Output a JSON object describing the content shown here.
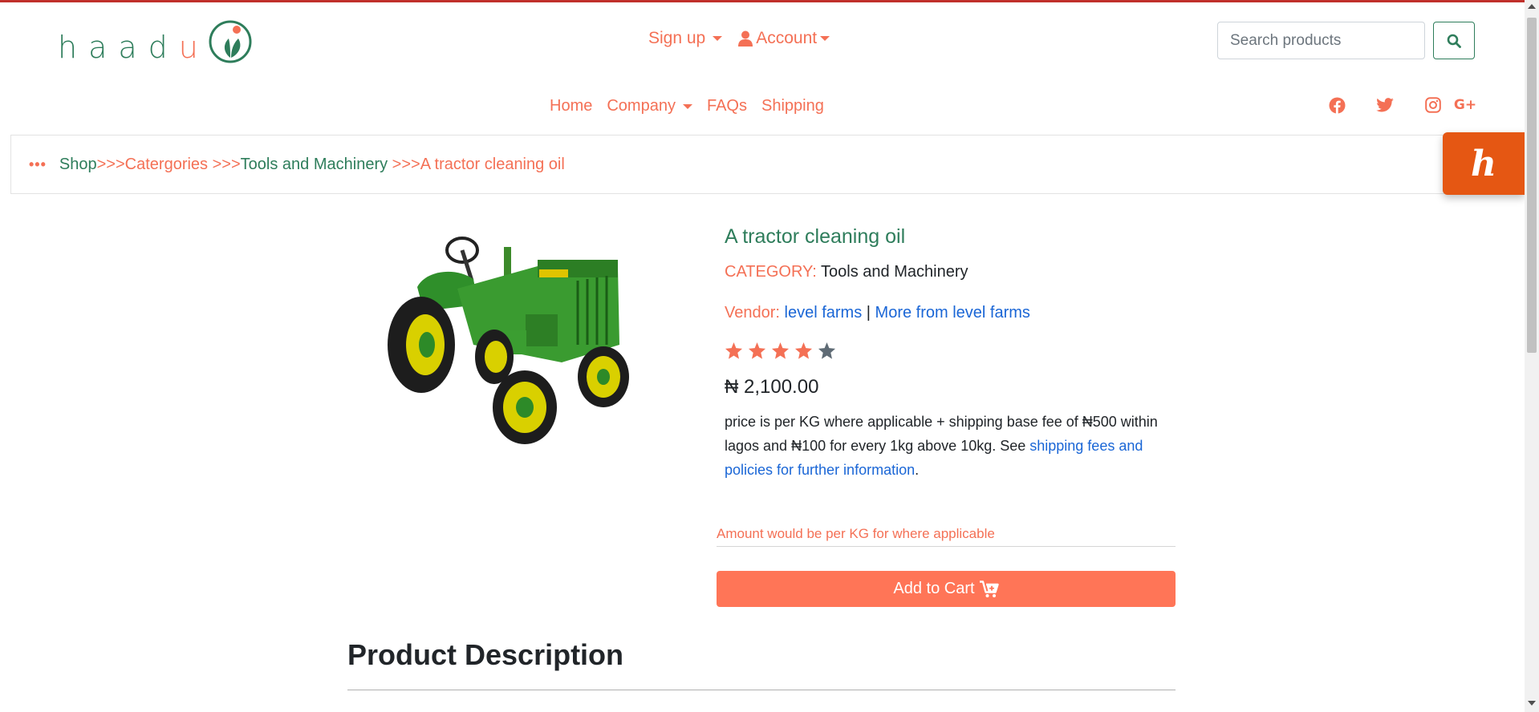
{
  "brand": {
    "logo_text_main": "haad",
    "logo_text_accent": "u"
  },
  "topnav": {
    "signup_label": "Sign up",
    "account_label": "Account"
  },
  "search": {
    "placeholder": "Search products"
  },
  "mainnav": {
    "home": "Home",
    "company": "Company",
    "faqs": "FAQs",
    "shipping": "Shipping"
  },
  "social": {
    "googleplus_label": "G+"
  },
  "breadcrumb": {
    "dots": "•••",
    "shop": "Shop",
    "sep1": ">>>",
    "categories": "Catergories",
    "sep2": " >>>",
    "category": "Tools and Machinery",
    "sep3": " >>>",
    "product": "A tractor cleaning oil"
  },
  "honey_badge": {
    "label": "h"
  },
  "product": {
    "title": "A tractor cleaning oil",
    "category_label": "CATEGORY:",
    "category_value": "Tools and Machinery",
    "vendor_label": "Vendor:",
    "vendor_name": "level farms",
    "vendor_sep": "|",
    "vendor_more": "More from level farms",
    "rating": 4,
    "rating_max": 5,
    "price": "₦ 2,100.00",
    "note_text": "price is per KG where applicable + shipping base fee of ₦500 within lagos and ₦100 for every 1kg above 10kg. See ",
    "note_link": "shipping fees and policies for further information",
    "note_end": ".",
    "amount_placeholder": "Amount would be per KG for where applicable",
    "add_to_cart_label": "Add to Cart"
  },
  "description": {
    "title": "Product Description"
  },
  "colors": {
    "brand_green": "#2e7d5b",
    "brand_orange": "#f47055",
    "cart_button": "#ff7557",
    "link_blue": "#1a66d6",
    "honey_orange": "#e55713",
    "star_filled": "#f47055",
    "star_empty": "#5f6b75"
  }
}
